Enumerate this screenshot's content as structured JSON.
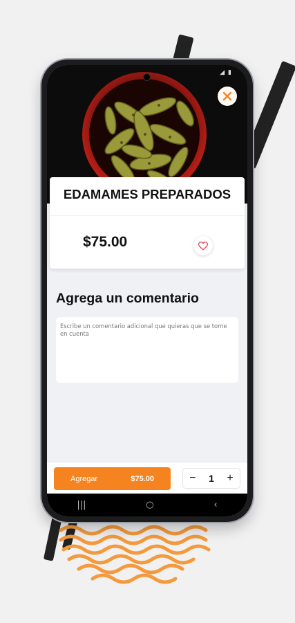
{
  "product": {
    "name": "EDAMAMES PREPARADOS",
    "price": "$75.00",
    "favorite_icon": "heart-outline-icon"
  },
  "comment": {
    "title": "Agrega un comentario",
    "placeholder": "Escribe un comentario adicional que quieras que se tome en cuenta",
    "value": ""
  },
  "footer": {
    "add_label": "Agregar",
    "add_price": "$75.00",
    "quantity": "1",
    "decrement": "−",
    "increment": "+"
  },
  "nav": {
    "recents": "|||",
    "home": "○",
    "back": "‹"
  },
  "colors": {
    "accent": "#f58420",
    "background": "#eff1f5",
    "heart": "#e0485c"
  },
  "icons": {
    "close": "close-icon",
    "status": "signal-battery-icon"
  }
}
